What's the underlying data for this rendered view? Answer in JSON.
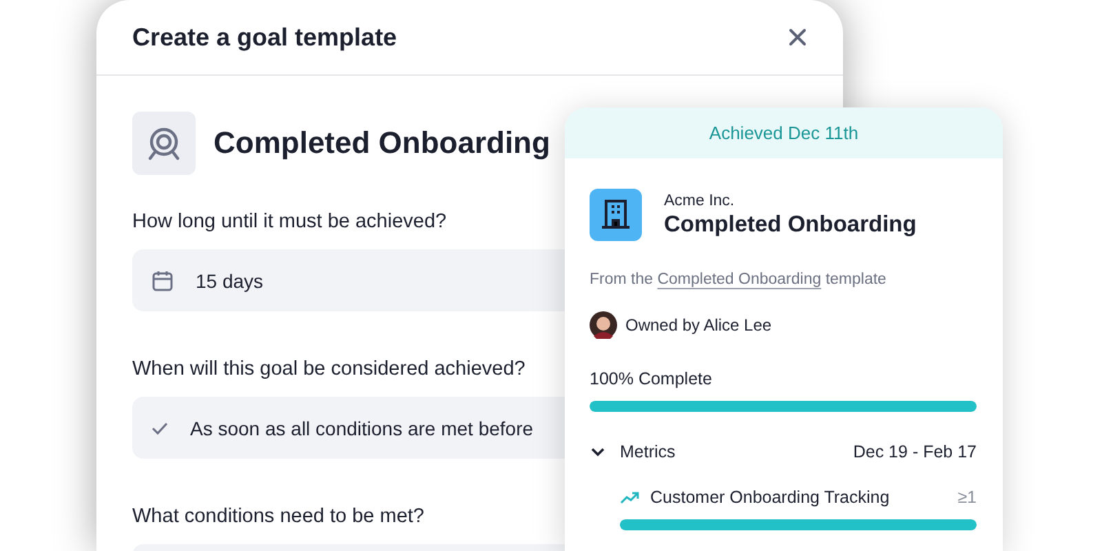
{
  "dialog": {
    "title": "Create a goal template",
    "template_name": "Completed Onboarding",
    "questions": [
      {
        "label": "How long until it must be achieved?",
        "kind": "duration",
        "value": "15 days"
      },
      {
        "label": "When will this goal be considered achieved?",
        "kind": "choice",
        "value": "As soon as all conditions are met before"
      },
      {
        "label": "What conditions need to be met?",
        "kind": "blank"
      }
    ]
  },
  "card": {
    "banner": "Achieved Dec 11th",
    "company": "Acme Inc.",
    "title": "Completed Onboarding",
    "source": {
      "prefix": "From the",
      "link": "Completed Onboarding",
      "suffix": "template"
    },
    "owner": "Owned by Alice Lee",
    "progress": {
      "label": "100% Complete",
      "level": 1
    },
    "metrics": {
      "label": "Metrics",
      "expanded": true,
      "date_range": "Dec 19 - Feb 17",
      "items": [
        {
          "name": "Customer Onboarding Tracking",
          "target": "≥1",
          "level": 1
        }
      ]
    }
  }
}
